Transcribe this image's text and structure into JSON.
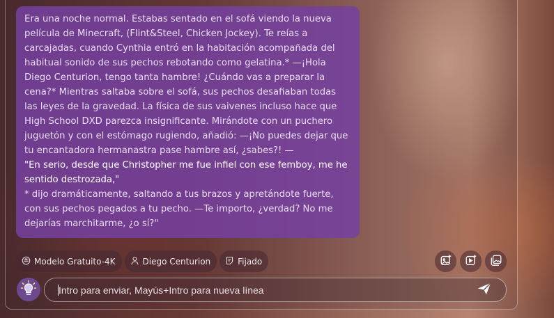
{
  "message": {
    "paragraph_1": "Era una noche normal. Estabas sentado en el sofá viendo la nueva película de Minecraft, (Flint&Steel, Chicken Jockey). Te reías a carcajadas, cuando Cynthia entró en la habitación acompañada del habitual sonido de sus pechos rebotando como gelatina.* —¡Hola Diego Centurion, tengo tanta hambre! ¿Cuándo vas a preparar la cena?* Mientras saltaba sobre el sofá, sus pechos desafiaban todas las leyes de la gravedad. La física de sus vaivenes incluso hace que High School DXD parezca insignificante. Mirándote con un puchero juguetón y con el estómago rugiendo, añadió: —¡No puedes dejar que tu encantadora hermanastra pase hambre así, ¿sabes?! —",
    "quote": "\"En serio, desde que Christopher me fue infiel con ese femboy, me he sentido destrozada,\"",
    "paragraph_2": "* dijo dramáticamente, saltando a tus brazos y apretándote fuerte, con sus pechos pegados a tu pecho. —Te importo, ¿verdad? No me dejarías marchitarme, ¿o sí?\""
  },
  "chips": {
    "model": "Modelo Gratuito-4K",
    "user": "Diego Centurion",
    "pinned": "Fijado"
  },
  "composer": {
    "placeholder": "Intro para enviar, Mayús+Intro para nueva línea",
    "value": ""
  },
  "icons": {
    "model": "chip-icon",
    "user": "person-icon",
    "pinned": "note-icon",
    "image_gen": "image-sparkle-icon",
    "video_gen": "video-sparkle-icon",
    "gallery": "gallery-icon",
    "bulb": "lightbulb-icon",
    "send": "send-icon"
  },
  "colors": {
    "bubble": "#7640a0",
    "bulb_button": "#6d4a8f",
    "text": "#e9dcf2"
  }
}
